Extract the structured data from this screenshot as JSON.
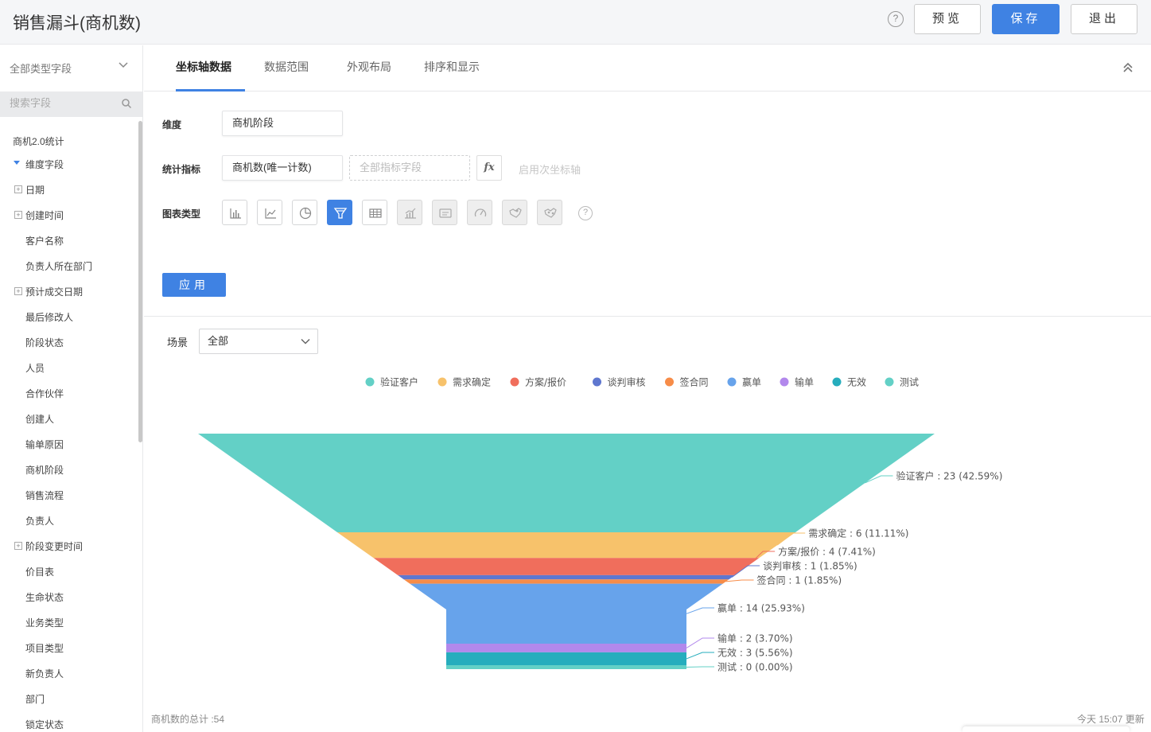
{
  "header": {
    "title": "销售漏斗(商机数)",
    "help_glyph": "?",
    "preview_label": "预览",
    "save_label": "保存",
    "exit_label": "退出"
  },
  "sidebar": {
    "field_type_label": "全部类型字段",
    "search_placeholder": "搜索字段",
    "items": [
      {
        "label": "商机2.0统计",
        "kind": "root"
      },
      {
        "label": "维度字段",
        "kind": "open"
      },
      {
        "label": "日期",
        "kind": "group"
      },
      {
        "label": "创建时间",
        "kind": "group"
      },
      {
        "label": "客户名称",
        "kind": "leaf"
      },
      {
        "label": "负责人所在部门",
        "kind": "leaf"
      },
      {
        "label": "预计成交日期",
        "kind": "group"
      },
      {
        "label": "最后修改人",
        "kind": "leaf"
      },
      {
        "label": "阶段状态",
        "kind": "leaf"
      },
      {
        "label": "人员",
        "kind": "leaf"
      },
      {
        "label": "合作伙伴",
        "kind": "leaf"
      },
      {
        "label": "创建人",
        "kind": "leaf"
      },
      {
        "label": "输单原因",
        "kind": "leaf"
      },
      {
        "label": "商机阶段",
        "kind": "leaf"
      },
      {
        "label": "销售流程",
        "kind": "leaf"
      },
      {
        "label": "负责人",
        "kind": "leaf"
      },
      {
        "label": "阶段变更时间",
        "kind": "group"
      },
      {
        "label": "价目表",
        "kind": "leaf"
      },
      {
        "label": "生命状态",
        "kind": "leaf"
      },
      {
        "label": "业务类型",
        "kind": "leaf"
      },
      {
        "label": "项目类型",
        "kind": "leaf"
      },
      {
        "label": "新负责人",
        "kind": "leaf"
      },
      {
        "label": "部门",
        "kind": "leaf"
      },
      {
        "label": "锁定状态",
        "kind": "leaf"
      }
    ]
  },
  "tabs": [
    {
      "label": "坐标轴数据",
      "active": true
    },
    {
      "label": "数据范围",
      "active": false
    },
    {
      "label": "外观布局",
      "active": false
    },
    {
      "label": "排序和显示",
      "active": false
    }
  ],
  "config": {
    "dimension_label": "维度",
    "dimension_value": "商机阶段",
    "metric_label": "统计指标",
    "metric_value": "商机数(唯一计数)",
    "metric_placeholder": "全部指标字段",
    "fx_label": "fx",
    "secondary_axis_label": "启用次坐标轴",
    "chart_type_label": "图表类型",
    "chart_types": [
      {
        "icon": "bar-chart-icon",
        "state": "normal"
      },
      {
        "icon": "line-chart-icon",
        "state": "normal"
      },
      {
        "icon": "pie-chart-icon",
        "state": "normal"
      },
      {
        "icon": "funnel-chart-icon",
        "state": "active"
      },
      {
        "icon": "table-chart-icon",
        "state": "normal"
      },
      {
        "icon": "bar-line-chart-icon",
        "state": "disabled"
      },
      {
        "icon": "card-chart-icon",
        "state": "disabled"
      },
      {
        "icon": "gauge-chart-icon",
        "state": "disabled"
      },
      {
        "icon": "map-chart-icon",
        "state": "disabled"
      },
      {
        "icon": "world-map-icon",
        "state": "disabled"
      }
    ],
    "help_glyph": "?",
    "apply_label": "应用"
  },
  "scene": {
    "label": "场景",
    "value": "全部"
  },
  "chart_data": {
    "type": "funnel",
    "legend_position": "top",
    "series": [
      {
        "name": "验证客户",
        "value": 23,
        "percent": "42.59%",
        "color": "#63d0c6",
        "label": "验证客户 : 23 (42.59%)"
      },
      {
        "name": "需求确定",
        "value": 6,
        "percent": "11.11%",
        "color": "#f7c26b",
        "label": "需求确定 : 6 (11.11%)"
      },
      {
        "name": "方案/报价",
        "value": 4,
        "percent": "7.41%",
        "color": "#f06e5c",
        "label": "方案/报价 : 4 (7.41%)"
      },
      {
        "name": "谈判审核",
        "value": 1,
        "percent": "1.85%",
        "color": "#5f77cf",
        "label": "谈判审核 : 1 (1.85%)"
      },
      {
        "name": "签合同",
        "value": 1,
        "percent": "1.85%",
        "color": "#f78c48",
        "label": "签合同 : 1 (1.85%)"
      },
      {
        "name": "赢单",
        "value": 14,
        "percent": "25.93%",
        "color": "#67a3eb",
        "label": "赢单 : 14 (25.93%)"
      },
      {
        "name": "输单",
        "value": 2,
        "percent": "3.70%",
        "color": "#b288ec",
        "label": "输单 : 2 (3.70%)"
      },
      {
        "name": "无效",
        "value": 3,
        "percent": "5.56%",
        "color": "#26adbd",
        "label": "无效 : 3 (5.56%)"
      },
      {
        "name": "测试",
        "value": 0,
        "percent": "0.00%",
        "color": "#63d0c6",
        "label": "测试 : 0 (0.00%)"
      }
    ]
  },
  "footer": {
    "total": "商机数的总计 :54",
    "updated": "今天 15:07 更新"
  }
}
